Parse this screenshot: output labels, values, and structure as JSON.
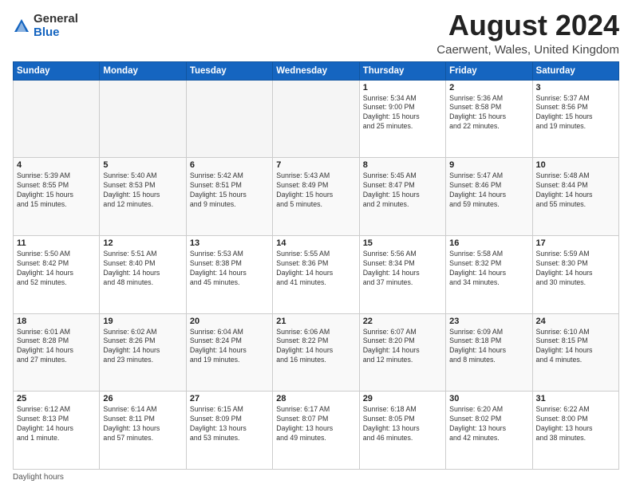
{
  "logo": {
    "general": "General",
    "blue": "Blue"
  },
  "title": "August 2024",
  "subtitle": "Caerwent, Wales, United Kingdom",
  "days_of_week": [
    "Sunday",
    "Monday",
    "Tuesday",
    "Wednesday",
    "Thursday",
    "Friday",
    "Saturday"
  ],
  "weeks": [
    [
      {
        "num": "",
        "info": "",
        "empty": true
      },
      {
        "num": "",
        "info": "",
        "empty": true
      },
      {
        "num": "",
        "info": "",
        "empty": true
      },
      {
        "num": "",
        "info": "",
        "empty": true
      },
      {
        "num": "1",
        "info": "Sunrise: 5:34 AM\nSunset: 9:00 PM\nDaylight: 15 hours\nand 25 minutes.",
        "empty": false
      },
      {
        "num": "2",
        "info": "Sunrise: 5:36 AM\nSunset: 8:58 PM\nDaylight: 15 hours\nand 22 minutes.",
        "empty": false
      },
      {
        "num": "3",
        "info": "Sunrise: 5:37 AM\nSunset: 8:56 PM\nDaylight: 15 hours\nand 19 minutes.",
        "empty": false
      }
    ],
    [
      {
        "num": "4",
        "info": "Sunrise: 5:39 AM\nSunset: 8:55 PM\nDaylight: 15 hours\nand 15 minutes.",
        "empty": false
      },
      {
        "num": "5",
        "info": "Sunrise: 5:40 AM\nSunset: 8:53 PM\nDaylight: 15 hours\nand 12 minutes.",
        "empty": false
      },
      {
        "num": "6",
        "info": "Sunrise: 5:42 AM\nSunset: 8:51 PM\nDaylight: 15 hours\nand 9 minutes.",
        "empty": false
      },
      {
        "num": "7",
        "info": "Sunrise: 5:43 AM\nSunset: 8:49 PM\nDaylight: 15 hours\nand 5 minutes.",
        "empty": false
      },
      {
        "num": "8",
        "info": "Sunrise: 5:45 AM\nSunset: 8:47 PM\nDaylight: 15 hours\nand 2 minutes.",
        "empty": false
      },
      {
        "num": "9",
        "info": "Sunrise: 5:47 AM\nSunset: 8:46 PM\nDaylight: 14 hours\nand 59 minutes.",
        "empty": false
      },
      {
        "num": "10",
        "info": "Sunrise: 5:48 AM\nSunset: 8:44 PM\nDaylight: 14 hours\nand 55 minutes.",
        "empty": false
      }
    ],
    [
      {
        "num": "11",
        "info": "Sunrise: 5:50 AM\nSunset: 8:42 PM\nDaylight: 14 hours\nand 52 minutes.",
        "empty": false
      },
      {
        "num": "12",
        "info": "Sunrise: 5:51 AM\nSunset: 8:40 PM\nDaylight: 14 hours\nand 48 minutes.",
        "empty": false
      },
      {
        "num": "13",
        "info": "Sunrise: 5:53 AM\nSunset: 8:38 PM\nDaylight: 14 hours\nand 45 minutes.",
        "empty": false
      },
      {
        "num": "14",
        "info": "Sunrise: 5:55 AM\nSunset: 8:36 PM\nDaylight: 14 hours\nand 41 minutes.",
        "empty": false
      },
      {
        "num": "15",
        "info": "Sunrise: 5:56 AM\nSunset: 8:34 PM\nDaylight: 14 hours\nand 37 minutes.",
        "empty": false
      },
      {
        "num": "16",
        "info": "Sunrise: 5:58 AM\nSunset: 8:32 PM\nDaylight: 14 hours\nand 34 minutes.",
        "empty": false
      },
      {
        "num": "17",
        "info": "Sunrise: 5:59 AM\nSunset: 8:30 PM\nDaylight: 14 hours\nand 30 minutes.",
        "empty": false
      }
    ],
    [
      {
        "num": "18",
        "info": "Sunrise: 6:01 AM\nSunset: 8:28 PM\nDaylight: 14 hours\nand 27 minutes.",
        "empty": false
      },
      {
        "num": "19",
        "info": "Sunrise: 6:02 AM\nSunset: 8:26 PM\nDaylight: 14 hours\nand 23 minutes.",
        "empty": false
      },
      {
        "num": "20",
        "info": "Sunrise: 6:04 AM\nSunset: 8:24 PM\nDaylight: 14 hours\nand 19 minutes.",
        "empty": false
      },
      {
        "num": "21",
        "info": "Sunrise: 6:06 AM\nSunset: 8:22 PM\nDaylight: 14 hours\nand 16 minutes.",
        "empty": false
      },
      {
        "num": "22",
        "info": "Sunrise: 6:07 AM\nSunset: 8:20 PM\nDaylight: 14 hours\nand 12 minutes.",
        "empty": false
      },
      {
        "num": "23",
        "info": "Sunrise: 6:09 AM\nSunset: 8:18 PM\nDaylight: 14 hours\nand 8 minutes.",
        "empty": false
      },
      {
        "num": "24",
        "info": "Sunrise: 6:10 AM\nSunset: 8:15 PM\nDaylight: 14 hours\nand 4 minutes.",
        "empty": false
      }
    ],
    [
      {
        "num": "25",
        "info": "Sunrise: 6:12 AM\nSunset: 8:13 PM\nDaylight: 14 hours\nand 1 minute.",
        "empty": false
      },
      {
        "num": "26",
        "info": "Sunrise: 6:14 AM\nSunset: 8:11 PM\nDaylight: 13 hours\nand 57 minutes.",
        "empty": false
      },
      {
        "num": "27",
        "info": "Sunrise: 6:15 AM\nSunset: 8:09 PM\nDaylight: 13 hours\nand 53 minutes.",
        "empty": false
      },
      {
        "num": "28",
        "info": "Sunrise: 6:17 AM\nSunset: 8:07 PM\nDaylight: 13 hours\nand 49 minutes.",
        "empty": false
      },
      {
        "num": "29",
        "info": "Sunrise: 6:18 AM\nSunset: 8:05 PM\nDaylight: 13 hours\nand 46 minutes.",
        "empty": false
      },
      {
        "num": "30",
        "info": "Sunrise: 6:20 AM\nSunset: 8:02 PM\nDaylight: 13 hours\nand 42 minutes.",
        "empty": false
      },
      {
        "num": "31",
        "info": "Sunrise: 6:22 AM\nSunset: 8:00 PM\nDaylight: 13 hours\nand 38 minutes.",
        "empty": false
      }
    ]
  ],
  "footer": "Daylight hours"
}
